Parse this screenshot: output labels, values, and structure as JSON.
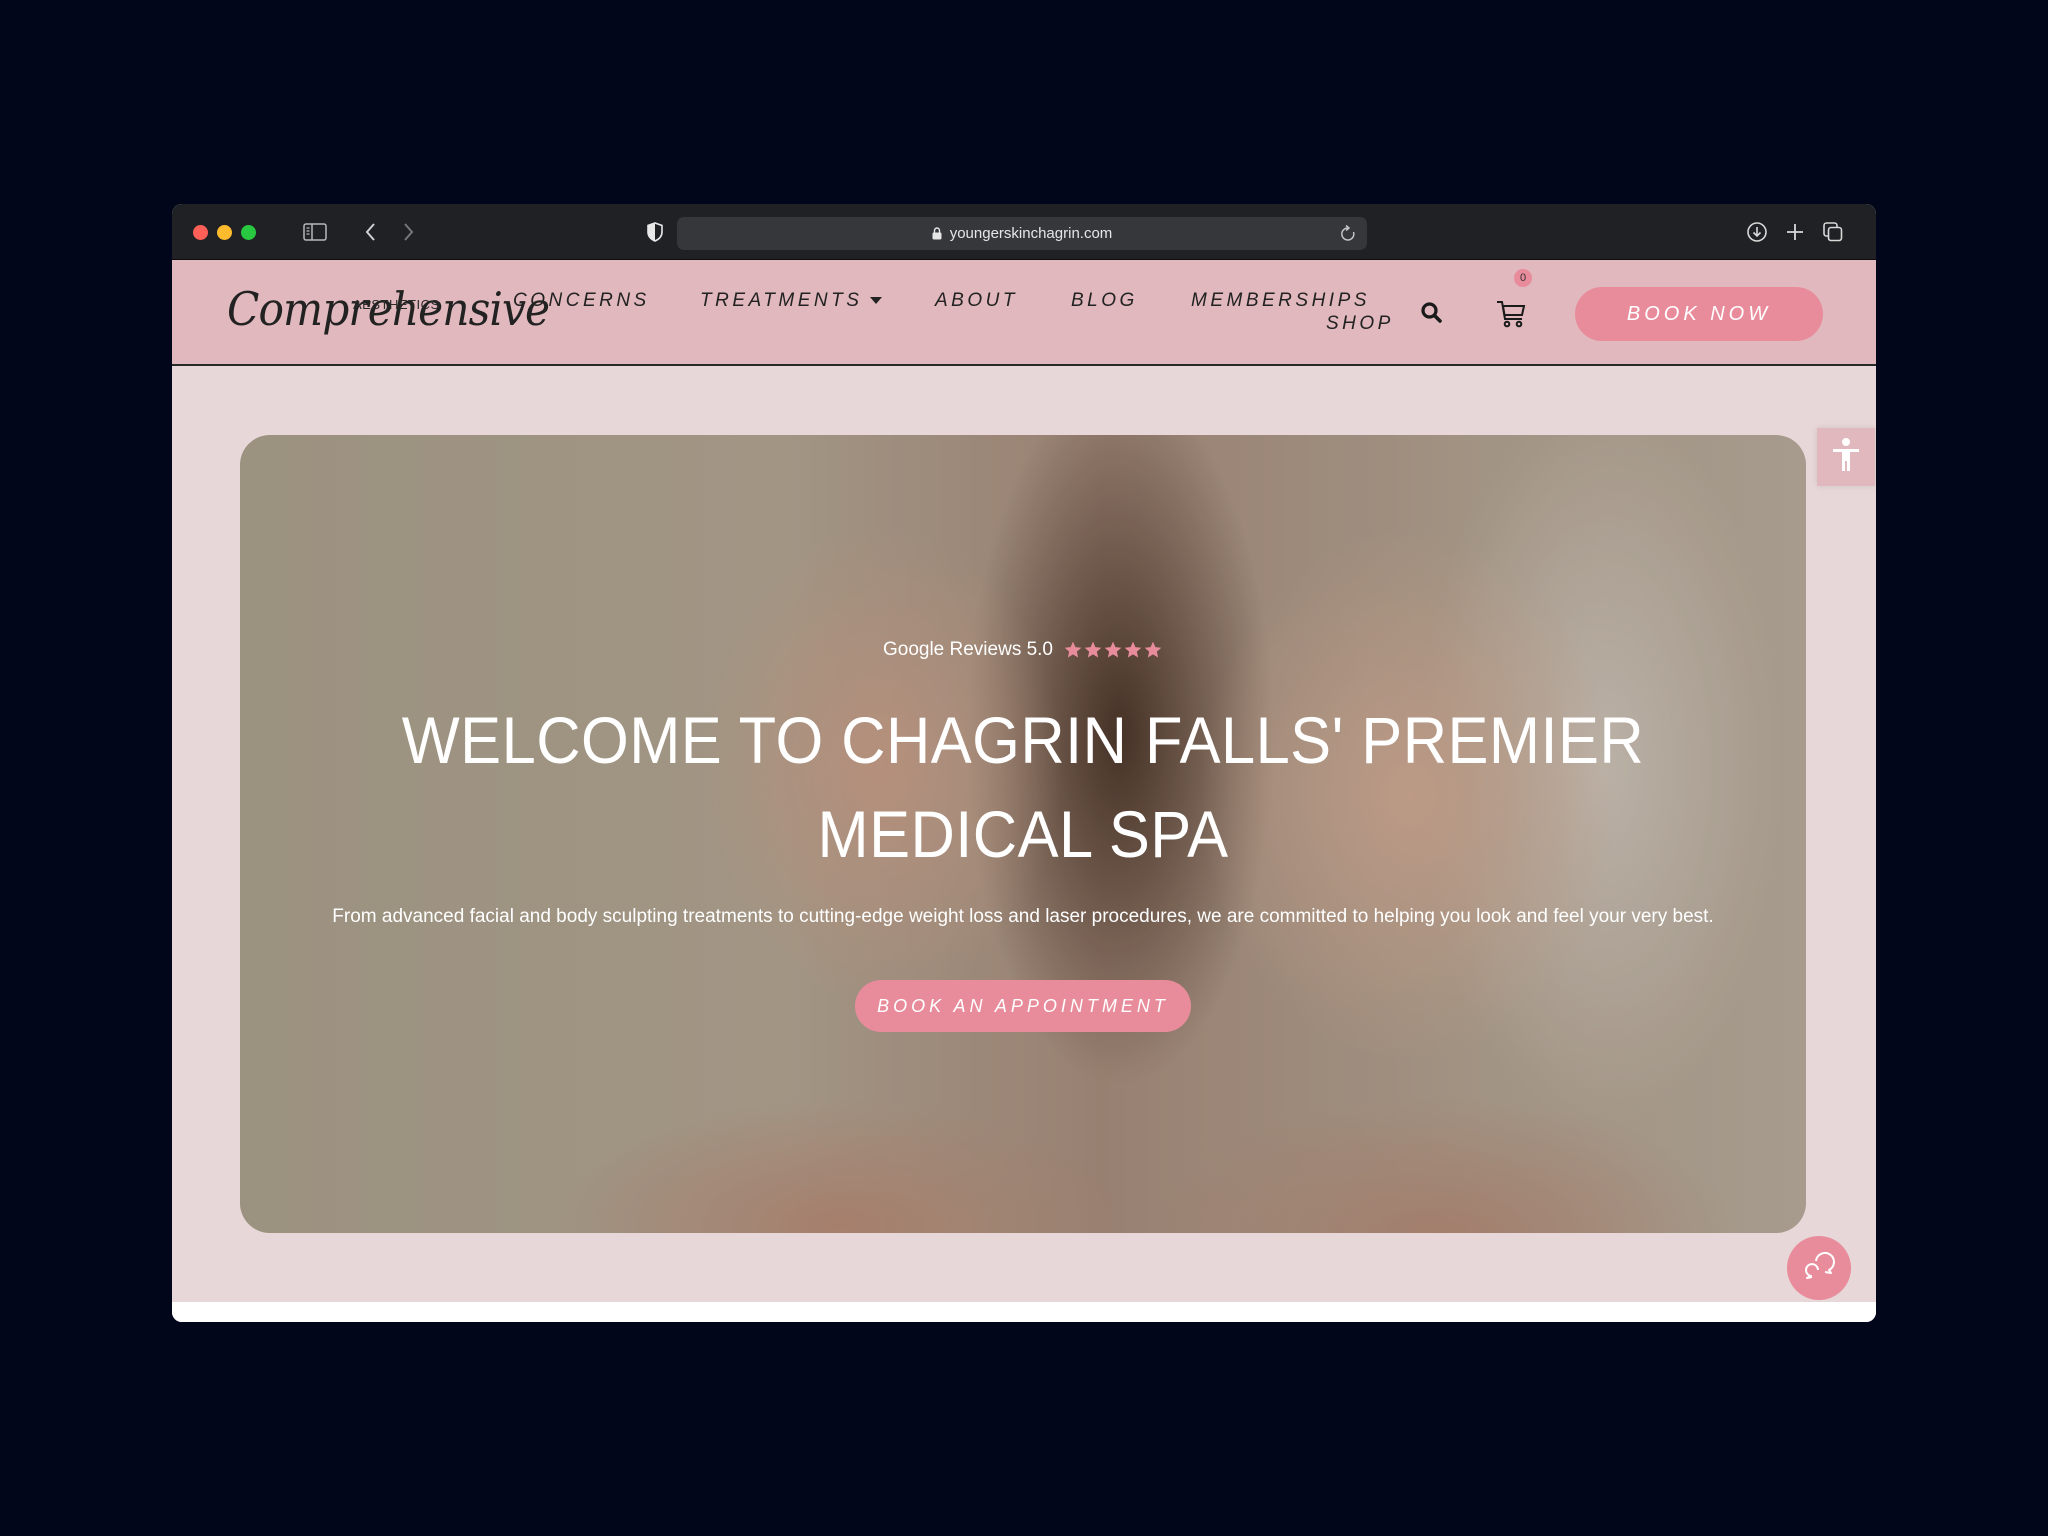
{
  "browser": {
    "url": "youngerskinchagrin.com",
    "icons": [
      "sidebar-toggle-icon",
      "back-chevron-icon",
      "forward-chevron-icon",
      "privacy-shield-icon",
      "lock-icon",
      "reload-icon",
      "download-icon",
      "new-tab-plus-icon",
      "tab-overview-icon"
    ]
  },
  "site": {
    "logo": {
      "script": "Comprehensive",
      "tagline": "AESTHETICS"
    },
    "nav": {
      "items": [
        {
          "label": "CONCERNS"
        },
        {
          "label": "TREATMENTS",
          "has_dropdown": true
        },
        {
          "label": "ABOUT"
        },
        {
          "label": "BLOG"
        },
        {
          "label": "MEMBERSHIPS"
        },
        {
          "label": "SHOP"
        }
      ],
      "cart_count": "0",
      "book_now": "BOOK NOW"
    },
    "hero": {
      "reviews_label": "Google Reviews 5.0",
      "rating": 5,
      "rating_max": 5,
      "title": "WELCOME TO CHAGRIN FALLS' PREMIER MEDICAL SPA",
      "subtitle": "From advanced facial and body sculpting treatments to cutting-edge weight loss and laser procedures, we are committed to helping you look and feel your very best.",
      "cta": "BOOK AN APPOINTMENT"
    },
    "colors": {
      "accent_pink": "#e88c9c",
      "nav_bg": "#e0b8bd",
      "page_bg": "#e7d7d8"
    }
  }
}
